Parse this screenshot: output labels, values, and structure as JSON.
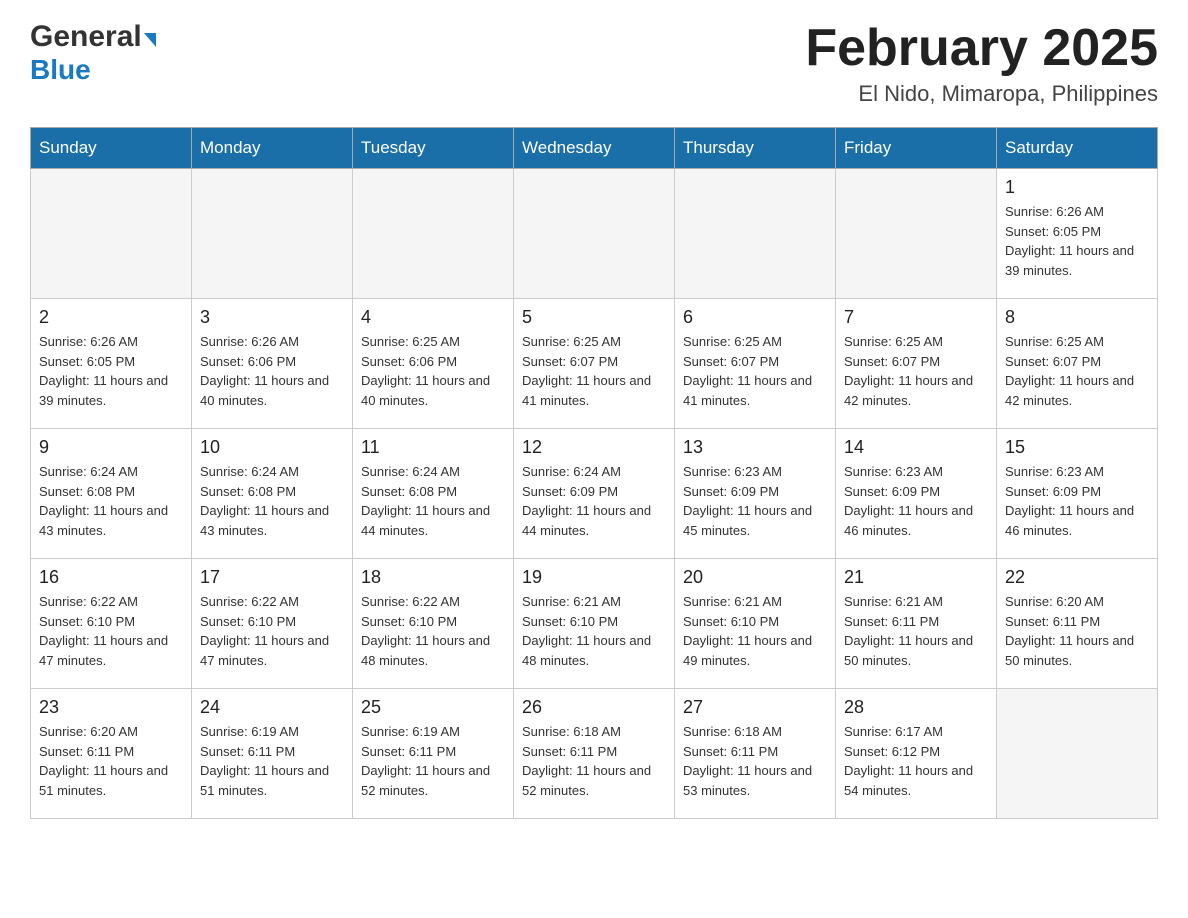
{
  "header": {
    "logo_general": "General",
    "logo_blue": "Blue",
    "main_title": "February 2025",
    "subtitle": "El Nido, Mimaropa, Philippines"
  },
  "days_of_week": [
    "Sunday",
    "Monday",
    "Tuesday",
    "Wednesday",
    "Thursday",
    "Friday",
    "Saturday"
  ],
  "weeks": [
    [
      {
        "day": "",
        "empty": true
      },
      {
        "day": "",
        "empty": true
      },
      {
        "day": "",
        "empty": true
      },
      {
        "day": "",
        "empty": true
      },
      {
        "day": "",
        "empty": true
      },
      {
        "day": "",
        "empty": true
      },
      {
        "day": "1",
        "sunrise": "6:26 AM",
        "sunset": "6:05 PM",
        "daylight": "11 hours and 39 minutes."
      }
    ],
    [
      {
        "day": "2",
        "sunrise": "6:26 AM",
        "sunset": "6:05 PM",
        "daylight": "11 hours and 39 minutes."
      },
      {
        "day": "3",
        "sunrise": "6:26 AM",
        "sunset": "6:06 PM",
        "daylight": "11 hours and 40 minutes."
      },
      {
        "day": "4",
        "sunrise": "6:25 AM",
        "sunset": "6:06 PM",
        "daylight": "11 hours and 40 minutes."
      },
      {
        "day": "5",
        "sunrise": "6:25 AM",
        "sunset": "6:07 PM",
        "daylight": "11 hours and 41 minutes."
      },
      {
        "day": "6",
        "sunrise": "6:25 AM",
        "sunset": "6:07 PM",
        "daylight": "11 hours and 41 minutes."
      },
      {
        "day": "7",
        "sunrise": "6:25 AM",
        "sunset": "6:07 PM",
        "daylight": "11 hours and 42 minutes."
      },
      {
        "day": "8",
        "sunrise": "6:25 AM",
        "sunset": "6:07 PM",
        "daylight": "11 hours and 42 minutes."
      }
    ],
    [
      {
        "day": "9",
        "sunrise": "6:24 AM",
        "sunset": "6:08 PM",
        "daylight": "11 hours and 43 minutes."
      },
      {
        "day": "10",
        "sunrise": "6:24 AM",
        "sunset": "6:08 PM",
        "daylight": "11 hours and 43 minutes."
      },
      {
        "day": "11",
        "sunrise": "6:24 AM",
        "sunset": "6:08 PM",
        "daylight": "11 hours and 44 minutes."
      },
      {
        "day": "12",
        "sunrise": "6:24 AM",
        "sunset": "6:09 PM",
        "daylight": "11 hours and 44 minutes."
      },
      {
        "day": "13",
        "sunrise": "6:23 AM",
        "sunset": "6:09 PM",
        "daylight": "11 hours and 45 minutes."
      },
      {
        "day": "14",
        "sunrise": "6:23 AM",
        "sunset": "6:09 PM",
        "daylight": "11 hours and 46 minutes."
      },
      {
        "day": "15",
        "sunrise": "6:23 AM",
        "sunset": "6:09 PM",
        "daylight": "11 hours and 46 minutes."
      }
    ],
    [
      {
        "day": "16",
        "sunrise": "6:22 AM",
        "sunset": "6:10 PM",
        "daylight": "11 hours and 47 minutes."
      },
      {
        "day": "17",
        "sunrise": "6:22 AM",
        "sunset": "6:10 PM",
        "daylight": "11 hours and 47 minutes."
      },
      {
        "day": "18",
        "sunrise": "6:22 AM",
        "sunset": "6:10 PM",
        "daylight": "11 hours and 48 minutes."
      },
      {
        "day": "19",
        "sunrise": "6:21 AM",
        "sunset": "6:10 PM",
        "daylight": "11 hours and 48 minutes."
      },
      {
        "day": "20",
        "sunrise": "6:21 AM",
        "sunset": "6:10 PM",
        "daylight": "11 hours and 49 minutes."
      },
      {
        "day": "21",
        "sunrise": "6:21 AM",
        "sunset": "6:11 PM",
        "daylight": "11 hours and 50 minutes."
      },
      {
        "day": "22",
        "sunrise": "6:20 AM",
        "sunset": "6:11 PM",
        "daylight": "11 hours and 50 minutes."
      }
    ],
    [
      {
        "day": "23",
        "sunrise": "6:20 AM",
        "sunset": "6:11 PM",
        "daylight": "11 hours and 51 minutes."
      },
      {
        "day": "24",
        "sunrise": "6:19 AM",
        "sunset": "6:11 PM",
        "daylight": "11 hours and 51 minutes."
      },
      {
        "day": "25",
        "sunrise": "6:19 AM",
        "sunset": "6:11 PM",
        "daylight": "11 hours and 52 minutes."
      },
      {
        "day": "26",
        "sunrise": "6:18 AM",
        "sunset": "6:11 PM",
        "daylight": "11 hours and 52 minutes."
      },
      {
        "day": "27",
        "sunrise": "6:18 AM",
        "sunset": "6:11 PM",
        "daylight": "11 hours and 53 minutes."
      },
      {
        "day": "28",
        "sunrise": "6:17 AM",
        "sunset": "6:12 PM",
        "daylight": "11 hours and 54 minutes."
      },
      {
        "day": "",
        "empty": true
      }
    ]
  ]
}
